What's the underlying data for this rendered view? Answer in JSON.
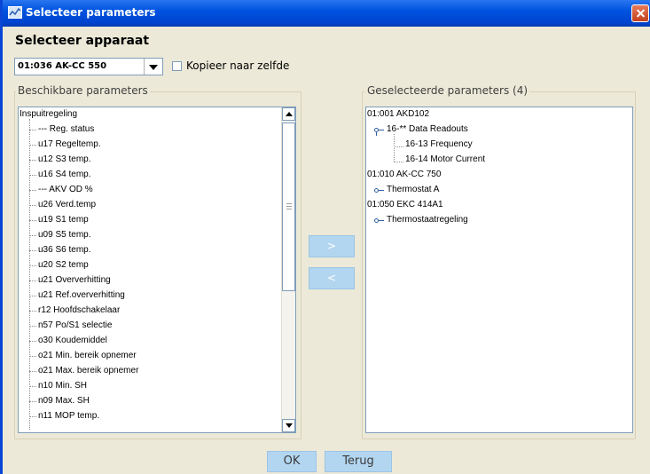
{
  "window": {
    "title": "Selecteer parameters"
  },
  "device": {
    "heading": "Selecteer apparaat",
    "selected": "01:036 AK-CC 550",
    "copy_checkbox_label": "Kopieer naar zelfde"
  },
  "available": {
    "title": "Beschikbare parameters",
    "items": [
      "Inspuitregeling",
      "--- Reg. status",
      "u17 Regeltemp.",
      "u12 S3 temp.",
      "u16 S4 temp.",
      "--- AKV OD %",
      "u26 Verd.temp",
      "u19 S1 temp",
      "u09 S5 temp.",
      "u36 S6 temp.",
      "u20 S2 temp",
      "u21 Oververhitting",
      "u21 Ref.oververhitting",
      "r12 Hoofdschakelaar",
      "n57 Po/S1 selectie",
      "o30 Koudemiddel",
      "o21 Min. bereik opnemer",
      "o21 Max. bereik opnemer",
      "n10 Min. SH",
      "n09 Max. SH",
      "n11 MOP temp."
    ]
  },
  "selected": {
    "title": "Geselecteerde parameters (4)",
    "items": [
      "01:001 AKD102",
      "16-** Data Readouts",
      "16-13 Frequency",
      "16-14 Motor Current",
      "01:010 AK-CC 750",
      "Thermostat A",
      "01:050 EKC 414A1",
      "Thermostaatregeling"
    ]
  },
  "buttons": {
    "add": ">",
    "remove": "<",
    "ok": "OK",
    "back": "Terug"
  },
  "colors": {
    "title_bar": "#0053e0",
    "button_face": "#b3d6f0",
    "window_bg": "#ece9d8"
  }
}
